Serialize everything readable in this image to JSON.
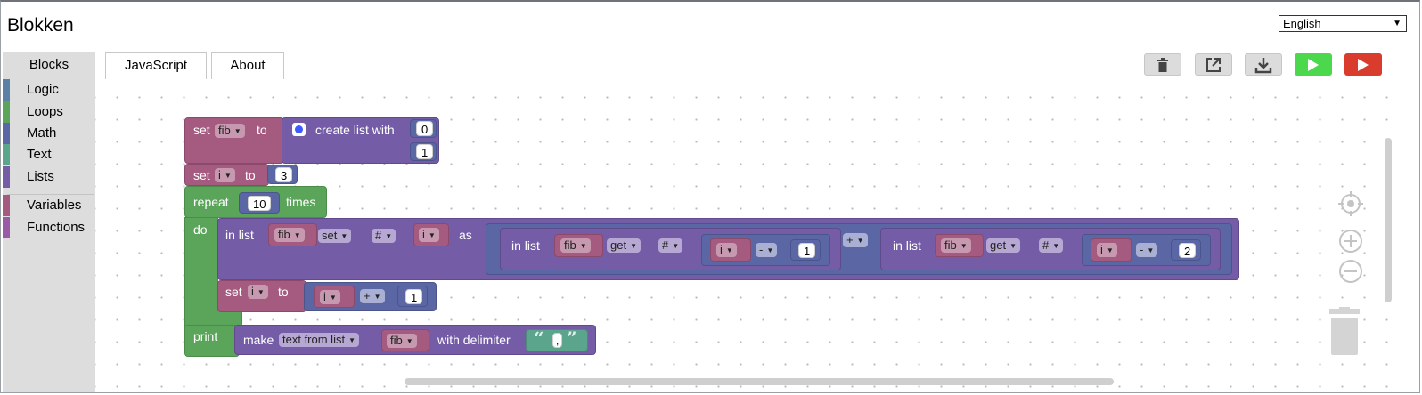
{
  "app": {
    "title": "Blokken"
  },
  "language": {
    "selected": "English"
  },
  "tabs": [
    {
      "label": "Blocks"
    },
    {
      "label": "JavaScript"
    },
    {
      "label": "About"
    }
  ],
  "toolbar": {
    "trash_icon": "trash-icon",
    "link_icon": "external-link-icon",
    "download_icon": "download-icon",
    "run_icon": "play-icon",
    "run_color": "#4cd84c",
    "stop_color": "#d93b2d"
  },
  "toolbox": {
    "categories": [
      {
        "label": "Logic",
        "color": "#5b80a5"
      },
      {
        "label": "Loops",
        "color": "#5ba55b"
      },
      {
        "label": "Math",
        "color": "#5b67a5"
      },
      {
        "label": "Text",
        "color": "#5ba58c"
      },
      {
        "label": "Lists",
        "color": "#745ca6"
      },
      {
        "label": "Variables",
        "color": "#a55b80"
      },
      {
        "label": "Functions",
        "color": "#995ba5"
      }
    ]
  },
  "program": {
    "set_fib": {
      "kw_set": "set",
      "var": "fib",
      "kw_to": "to",
      "create": "create list with",
      "items": [
        "0",
        "1"
      ]
    },
    "set_i": {
      "kw_set": "set",
      "var": "i",
      "kw_to": "to",
      "value": "3"
    },
    "repeat": {
      "kw_repeat": "repeat",
      "count": "10",
      "kw_times": "times",
      "kw_do": "do"
    },
    "list_set": {
      "kw_in_list": "in list",
      "list": "fib",
      "mode": "set",
      "where": "#",
      "index": "i",
      "kw_as": "as",
      "left": {
        "kw_in_list": "in list",
        "list": "fib",
        "mode": "get",
        "where": "#",
        "var": "i",
        "op": "-",
        "num": "1"
      },
      "plus": "+",
      "right": {
        "kw_in_list": "in list",
        "list": "fib",
        "mode": "get",
        "where": "#",
        "var": "i",
        "op": "-",
        "num": "2"
      }
    },
    "set_i_inc": {
      "kw_set": "set",
      "var": "i",
      "kw_to": "to",
      "lhs": "i",
      "op": "+",
      "num": "1"
    },
    "print": {
      "kw_print": "print",
      "kw_make": "make",
      "mode": "text from list",
      "list": "fib",
      "kw_delim": "with delimiter",
      "delimiter": ","
    }
  },
  "colors": {
    "variables": "#a55b80",
    "lists": "#745ca6",
    "math": "#5b67a5",
    "loops": "#5ba55b",
    "text": "#5ba58c"
  }
}
